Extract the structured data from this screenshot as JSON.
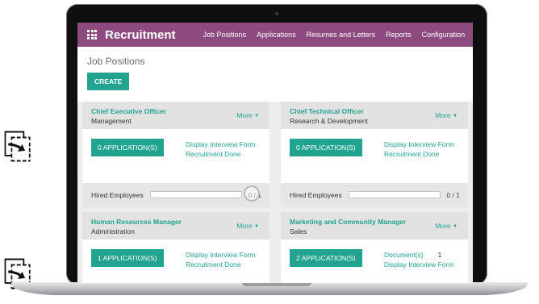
{
  "app": {
    "title": "Recruitment",
    "nav": [
      "Job Positions",
      "Applications",
      "Resumes and Letters",
      "Reports",
      "Configuration"
    ]
  },
  "page": {
    "breadcrumb": "Job Positions",
    "create_label": "CREATE"
  },
  "cards": [
    {
      "title": "Chief Executive Officer",
      "department": "Management",
      "more": "More",
      "applications": "0 APPLICATION(S)",
      "links": [
        "Display Interview Form",
        "Recruitment Done"
      ],
      "hired_label": "Hired Employees",
      "hired_count": "0 / 1",
      "hired_fraction": 0.0
    },
    {
      "title": "Chief Technical Officer",
      "department": "Research & Development",
      "more": "More",
      "applications": "0 APPLICATION(S)",
      "links": [
        "Display Interview Form",
        "Recruitment Done"
      ],
      "hired_label": "Hired Employees",
      "hired_count": "0 / 1",
      "hired_fraction": 0.0
    },
    {
      "title": "Human Resources Manager",
      "department": "Administration",
      "more": "More",
      "applications": "1 APPLICATION(S)",
      "links": [
        "Display Interview Form",
        "Recruitment Done"
      ]
    },
    {
      "title": "Marketing and Community Manager",
      "department": "Sales",
      "more": "More",
      "applications": "2 APPLICATION(S)",
      "links": [
        "Document(s)",
        "Display Interview Form"
      ],
      "document_count": "1"
    }
  ],
  "colors": {
    "brand": "#8d4a7f",
    "accent": "#21a38f",
    "panel": "#ededed"
  },
  "icons": {
    "apps_menu": "grid-icon",
    "more_caret": "caret-down-icon"
  }
}
